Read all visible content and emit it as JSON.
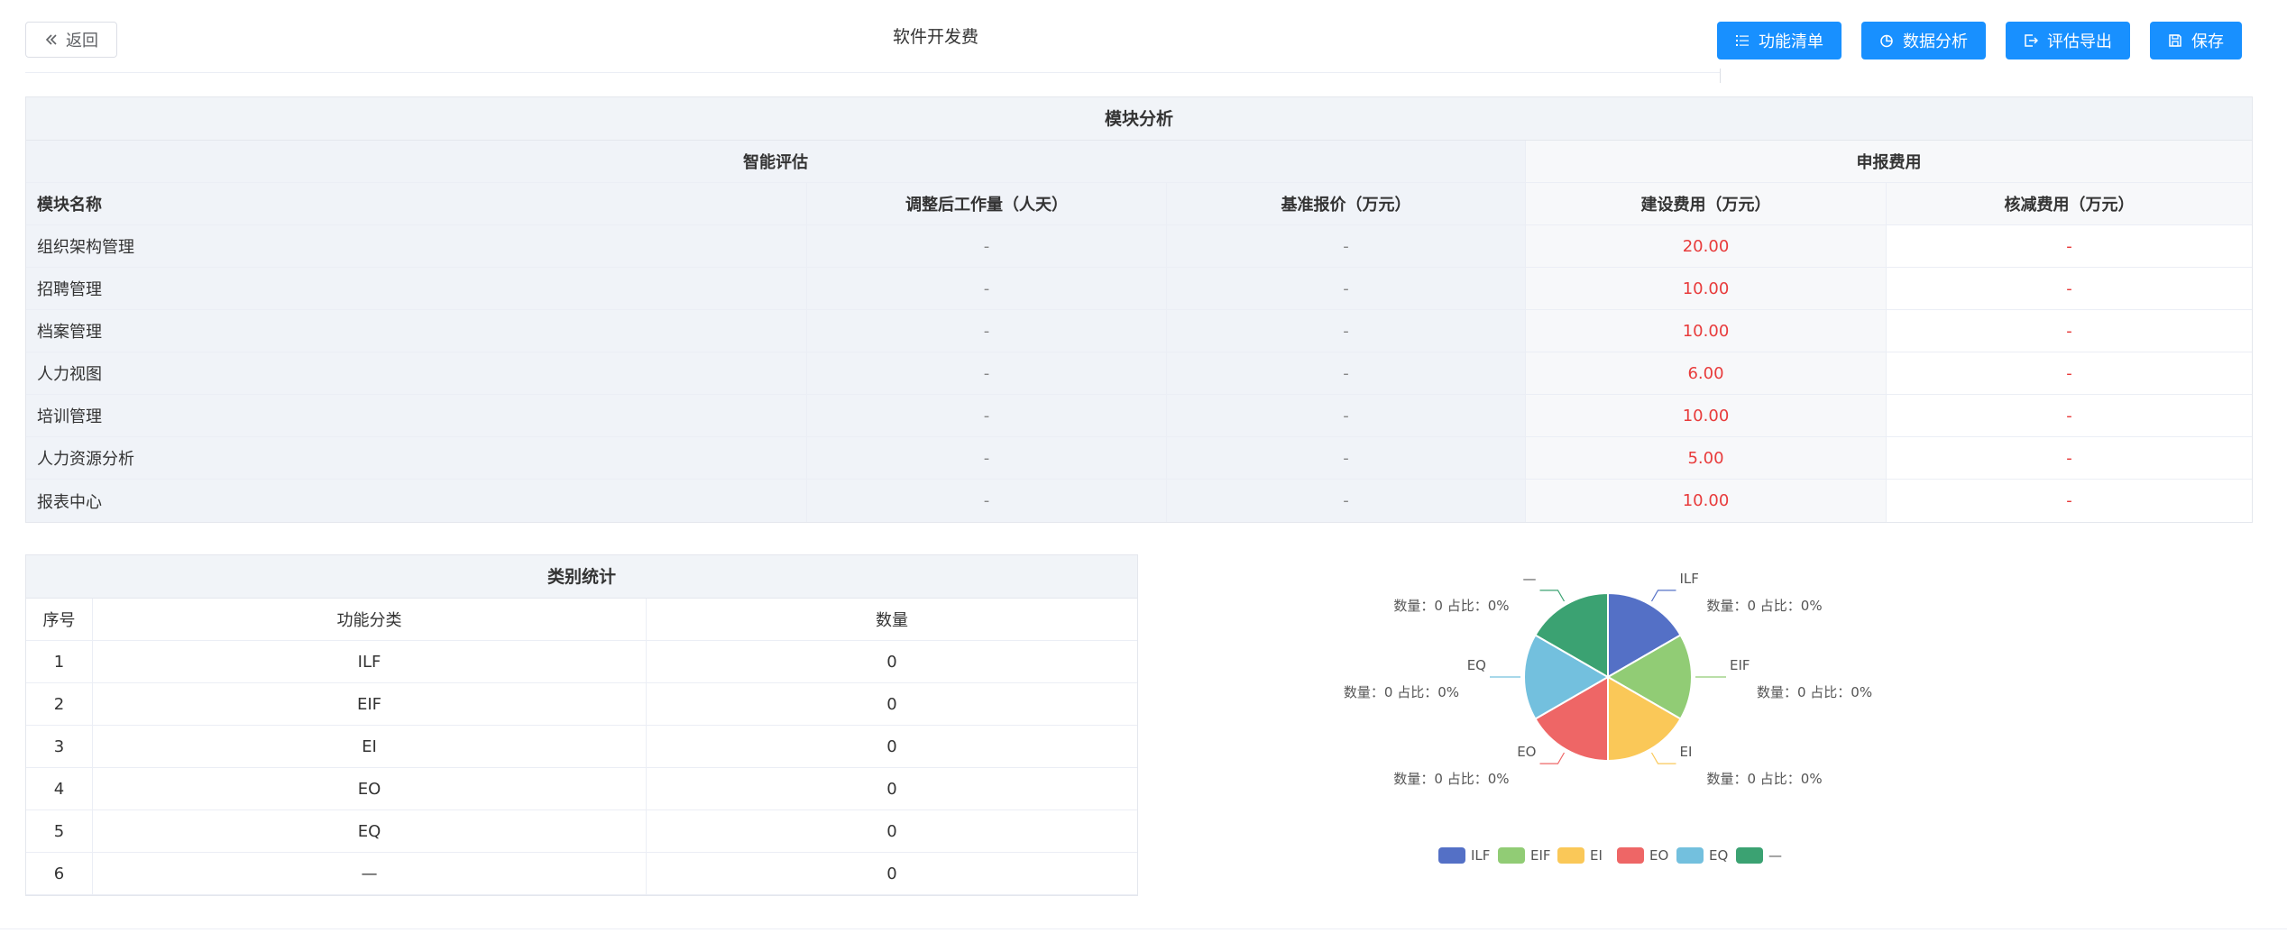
{
  "header": {
    "back_label": "返回",
    "title": "软件开发费",
    "buttons": [
      {
        "label": "功能清单",
        "icon": "list-icon"
      },
      {
        "label": "数据分析",
        "icon": "pie-icon"
      },
      {
        "label": "评估导出",
        "icon": "export-icon"
      },
      {
        "label": "保存",
        "icon": "save-icon"
      }
    ]
  },
  "module_table": {
    "title": "模块分析",
    "group_smart": "智能评估",
    "group_report": "申报费用",
    "columns": [
      "模块名称",
      "调整后工作量（人天）",
      "基准报价（万元）",
      "建设费用（万元）",
      "核减费用（万元）"
    ],
    "rows": [
      {
        "name": "组织架构管理",
        "work": "-",
        "base": "-",
        "build": "20.00",
        "cut": "-"
      },
      {
        "name": "招聘管理",
        "work": "-",
        "base": "-",
        "build": "10.00",
        "cut": "-"
      },
      {
        "name": "档案管理",
        "work": "-",
        "base": "-",
        "build": "10.00",
        "cut": "-"
      },
      {
        "name": "人力视图",
        "work": "-",
        "base": "-",
        "build": "6.00",
        "cut": "-"
      },
      {
        "name": "培训管理",
        "work": "-",
        "base": "-",
        "build": "10.00",
        "cut": "-"
      },
      {
        "name": "人力资源分析",
        "work": "-",
        "base": "-",
        "build": "5.00",
        "cut": "-"
      },
      {
        "name": "报表中心",
        "work": "-",
        "base": "-",
        "build": "10.00",
        "cut": "-"
      }
    ]
  },
  "category_table": {
    "title": "类别统计",
    "columns": [
      "序号",
      "功能分类",
      "数量"
    ],
    "rows": [
      {
        "idx": "1",
        "cat": "ILF",
        "count": "0"
      },
      {
        "idx": "2",
        "cat": "EIF",
        "count": "0"
      },
      {
        "idx": "3",
        "cat": "EI",
        "count": "0"
      },
      {
        "idx": "4",
        "cat": "EO",
        "count": "0"
      },
      {
        "idx": "5",
        "cat": "EQ",
        "count": "0"
      },
      {
        "idx": "6",
        "cat": "—",
        "count": "0"
      }
    ]
  },
  "chart_data": {
    "type": "pie",
    "categories": [
      "ILF",
      "EIF",
      "EI",
      "EO",
      "EQ",
      "—"
    ],
    "values": [
      0,
      0,
      0,
      0,
      0,
      0
    ],
    "labels": [
      "数量：0  占比：0%",
      "数量：0  占比：0%",
      "数量：0  占比：0%",
      "数量：0  占比：0%",
      "数量：0  占比：0%",
      "数量：0  占比：0%"
    ],
    "colors": [
      "#5470c6",
      "#91cc75",
      "#fac858",
      "#ee6666",
      "#73c0de",
      "#3ba272"
    ],
    "legend_position": "bottom"
  }
}
